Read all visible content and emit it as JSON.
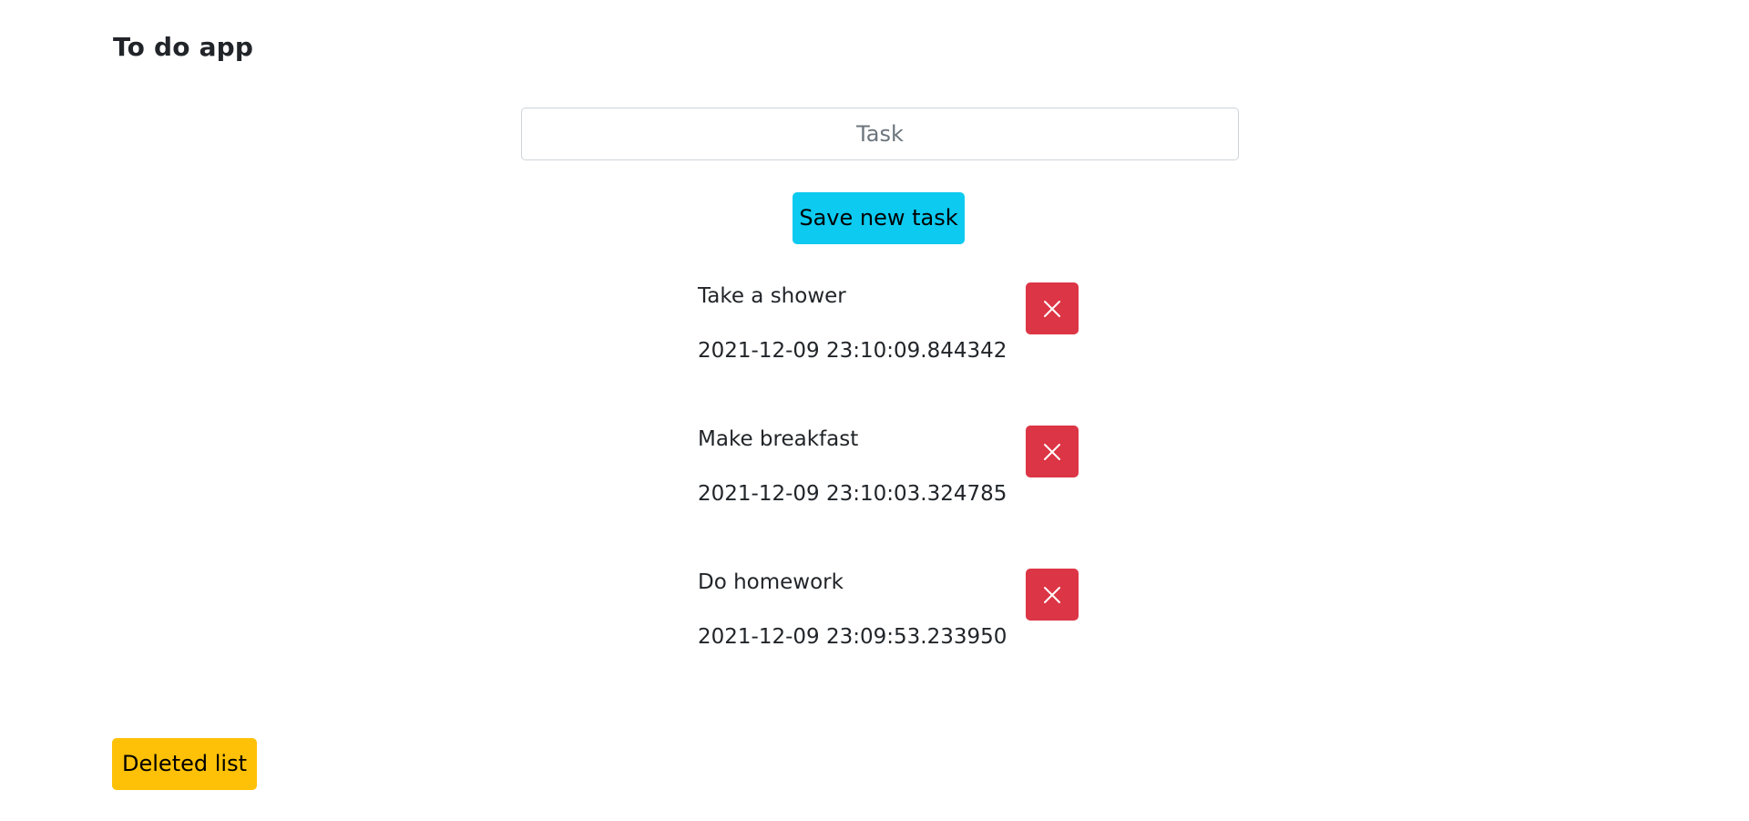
{
  "header": {
    "title": "To do app"
  },
  "task_form": {
    "placeholder": "Task",
    "value": "",
    "save_label": "Save new task"
  },
  "tasks": [
    {
      "name": "Take a shower",
      "timestamp": "2021-12-09 23:10:09.844342",
      "delete_icon": "close-icon"
    },
    {
      "name": "Make breakfast",
      "timestamp": "2021-12-09 23:10:03.324785",
      "delete_icon": "close-icon"
    },
    {
      "name": "Do homework",
      "timestamp": "2021-12-09 23:09:53.233950",
      "delete_icon": "close-icon"
    }
  ],
  "footer": {
    "deleted_list_label": "Deleted list"
  },
  "colors": {
    "save_button": "#0dcaf0",
    "delete_button": "#dc3545",
    "deleted_list_button": "#ffc107",
    "text": "#212529"
  }
}
